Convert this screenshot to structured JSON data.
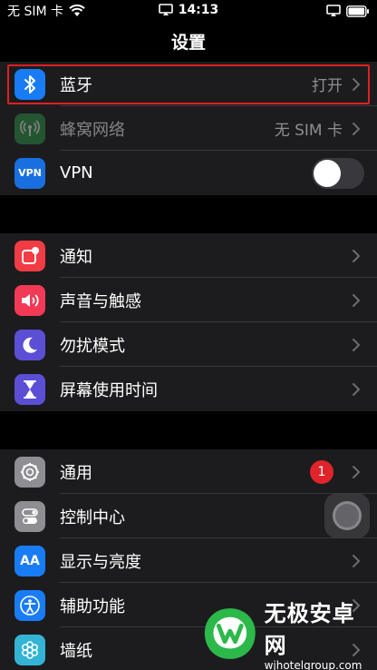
{
  "status_bar": {
    "carrier": "无 SIM 卡",
    "time": "14:13"
  },
  "nav": {
    "title": "设置"
  },
  "group1": [
    {
      "label": "蓝牙",
      "value": "打开",
      "icon": "bluetooth-icon",
      "color": "#1a7cf5"
    },
    {
      "label": "蜂窝网络",
      "value": "无 SIM 卡",
      "icon": "antenna-icon",
      "color": "#2f9b4a"
    },
    {
      "label": "VPN",
      "icon_text": "VPN",
      "icon": "vpn-icon",
      "color": "#1a6fe0",
      "toggle": "off"
    }
  ],
  "group2": [
    {
      "label": "通知",
      "icon": "notification-icon",
      "color": "#f13c45"
    },
    {
      "label": "声音与触感",
      "icon": "speaker-icon",
      "color": "#f23a56"
    },
    {
      "label": "勿扰模式",
      "icon": "moon-icon",
      "color": "#5b4fd6"
    },
    {
      "label": "屏幕使用时间",
      "icon": "hourglass-icon",
      "color": "#5b4fd6"
    }
  ],
  "group3": [
    {
      "label": "通用",
      "icon": "gear-icon",
      "color": "#8e8e93",
      "badge": "1"
    },
    {
      "label": "控制中心",
      "icon": "switches-icon",
      "color": "#8e8e93"
    },
    {
      "label": "显示与亮度",
      "icon_text": "AA",
      "icon": "display-icon",
      "color": "#1a7cf5"
    },
    {
      "label": "辅助功能",
      "icon": "accessibility-icon",
      "color": "#1a7cf5"
    },
    {
      "label": "墙纸",
      "icon": "wallpaper-icon",
      "color": "#34b4d4"
    }
  ],
  "watermark": {
    "title": "无极安卓网",
    "url": "wjhotelgroup.com"
  }
}
